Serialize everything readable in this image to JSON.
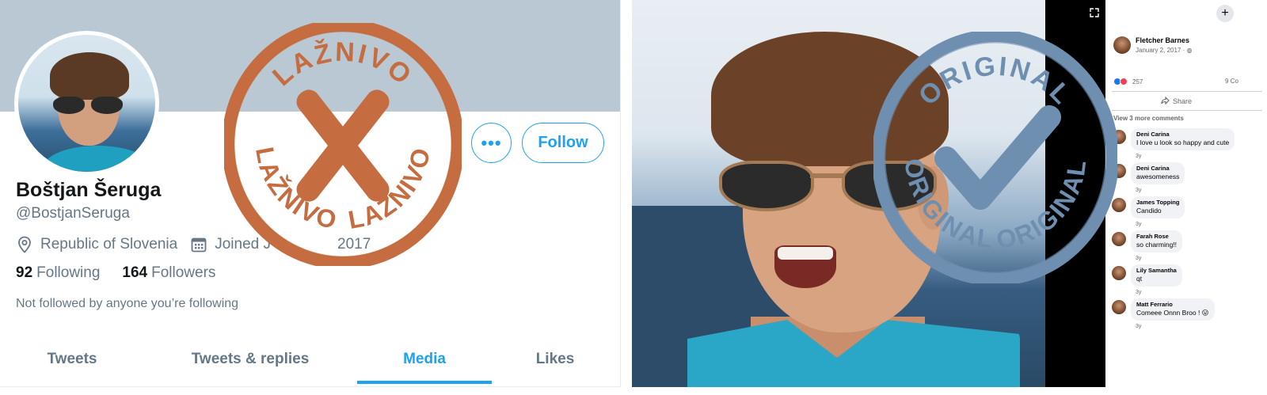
{
  "twitter": {
    "name": "Boštjan Šeruga",
    "handle": "@BostjanSeruga",
    "location": "Republic of Slovenia",
    "joined": "Joined J",
    "joined_tail": "2017",
    "following_count": "92",
    "following_label": "Following",
    "followers_count": "164",
    "followers_label": "Followers",
    "not_followed_note": "Not followed by anyone you’re following",
    "more_icon": "•••",
    "follow_label": "Follow",
    "tabs": [
      {
        "label": "Tweets"
      },
      {
        "label": "Tweets & replies"
      },
      {
        "label": "Media",
        "active": true
      },
      {
        "label": "Likes"
      }
    ],
    "accent_color": "#1da1f2"
  },
  "stamp_fake": {
    "text": "LAŽNIVO",
    "color": "#c56c40"
  },
  "stamp_original": {
    "text": "ORIGINAL",
    "color": "#6f8fb1"
  },
  "facebook": {
    "author": "Fletcher Barnes",
    "date": "January 2, 2017 · ",
    "reaction_count": "257",
    "comments_count": "9 Co",
    "share_label": "Share",
    "view_more": "View 3 more comments",
    "comments": [
      {
        "name": "Deni Carina",
        "text": "I love u look so happy and cute",
        "time": "3y"
      },
      {
        "name": "Deni Carina",
        "text": "awesomeness",
        "time": "3y"
      },
      {
        "name": "James Topping",
        "text": "Candido",
        "time": "3y"
      },
      {
        "name": "Farah Rose",
        "text": "so charming!!",
        "time": "3y"
      },
      {
        "name": "Lily Samantha",
        "text": "qt",
        "time": "3y"
      },
      {
        "name": "Matt Ferrario",
        "text": "Comeee Onnn Broo ! 😛",
        "time": "3y"
      }
    ]
  }
}
